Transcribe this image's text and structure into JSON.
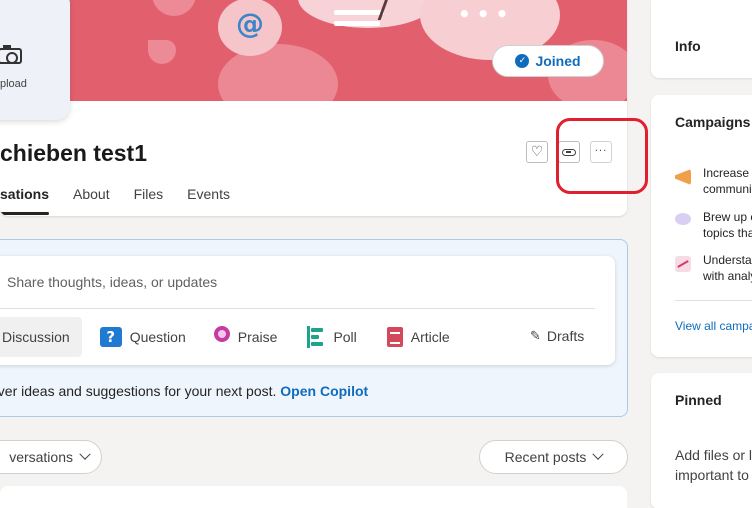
{
  "group": {
    "upload_label": "pload",
    "title": "chieben test1",
    "joined_label": "Joined"
  },
  "tabs": [
    "sations",
    "About",
    "Files",
    "Events"
  ],
  "composer": {
    "placeholder": "Share thoughts, ideas, or updates",
    "post_types": {
      "discussion": "Discussion",
      "question": "Question",
      "praise": "Praise",
      "poll": "Poll",
      "article": "Article"
    },
    "drafts_label": "Drafts"
  },
  "copilot": {
    "text": "over ideas and suggestions for your next post.",
    "link": "Open Copilot"
  },
  "filters": {
    "conversations": "versations",
    "sort": "Recent posts"
  },
  "sidebar": {
    "info_title": "Info",
    "campaigns_title": "Campaigns",
    "campaigns": [
      {
        "line1": "Increase c",
        "line2": "communi"
      },
      {
        "line1": "Brew up c",
        "line2": "topics tha"
      },
      {
        "line1": "Understa",
        "line2": "with analy"
      }
    ],
    "view_all": "View all campa",
    "pinned_title": "Pinned",
    "pinned_text_1": "Add files or l",
    "pinned_text_2": "important to"
  },
  "colors": {
    "cover": "#e2606e",
    "accent": "#0f6cbd",
    "highlight": "#e0202e"
  }
}
